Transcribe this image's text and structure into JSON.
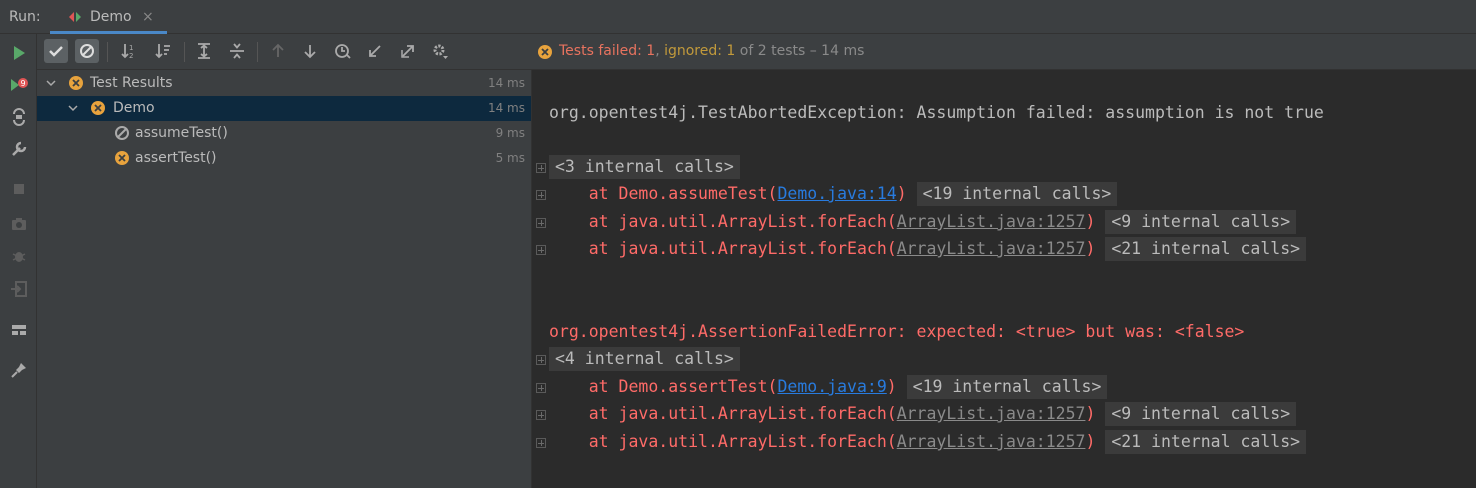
{
  "header": {
    "run_label": "Run:",
    "tab_label": "Demo",
    "tab_close": "×"
  },
  "tree": {
    "rows": [
      {
        "label": "Test Results",
        "time": "14 ms"
      },
      {
        "label": "Demo",
        "time": "14 ms"
      },
      {
        "label": "assumeTest()",
        "time": "9 ms"
      },
      {
        "label": "assertTest()",
        "time": "5 ms"
      }
    ]
  },
  "status": {
    "failed": "Tests failed: 1",
    "sep1": ", ",
    "ignored": "ignored: 1",
    "rest": " of 2 tests – 14 ms"
  },
  "console": {
    "exc1": "org.opentest4j.TestAbortedException: Assumption failed: assumption is not true",
    "exc1_fold": "<3 internal calls>",
    "exc1_lines": [
      {
        "pre": "    at Demo.assumeTest(",
        "link": "Demo.java:14",
        "post": ")",
        "fold": "<19 internal calls>"
      },
      {
        "pre": "    at java.util.ArrayList.forEach(",
        "link": "ArrayList.java:1257",
        "post": ")",
        "fold": "<9 internal calls>"
      },
      {
        "pre": "    at java.util.ArrayList.forEach(",
        "link": "ArrayList.java:1257",
        "post": ")",
        "fold": "<21 internal calls>"
      }
    ],
    "exc2": "org.opentest4j.AssertionFailedError: expected: <true> but was: <false>",
    "exc2_fold": "<4 internal calls>",
    "exc2_lines": [
      {
        "pre": "    at Demo.assertTest(",
        "link": "Demo.java:9",
        "post": ")",
        "fold": "<19 internal calls>"
      },
      {
        "pre": "    at java.util.ArrayList.forEach(",
        "link": "ArrayList.java:1257",
        "post": ")",
        "fold": "<9 internal calls>"
      },
      {
        "pre": "    at java.util.ArrayList.forEach(",
        "link": "ArrayList.java:1257",
        "post": ")",
        "fold": "<21 internal calls>"
      }
    ]
  },
  "colors": {
    "fail_icon": "#e8a33d",
    "run_green": "#59a869",
    "error_red": "#ff6b68",
    "link_blue": "#287bde",
    "selection": "#0d293e"
  }
}
